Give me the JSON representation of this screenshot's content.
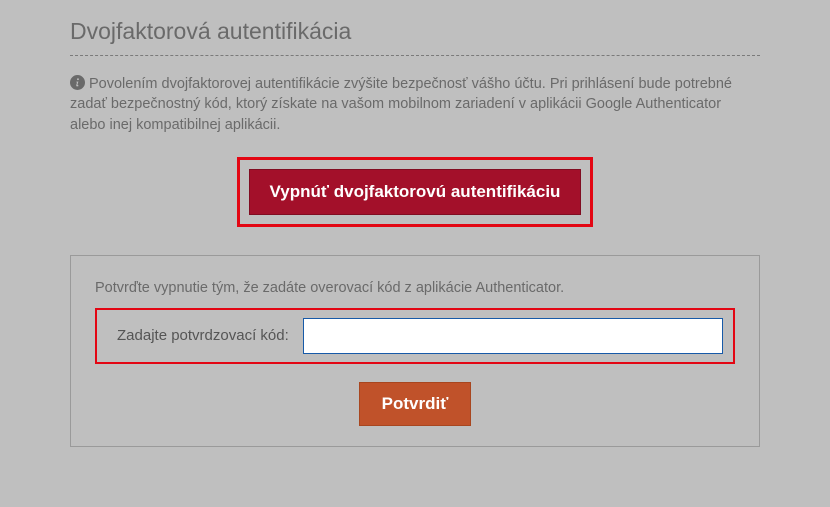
{
  "title": "Dvojfaktorová autentifikácia",
  "info_icon": "info-circle-icon",
  "info_text": "Povolením dvojfaktorovej autentifikácie zvýšite bezpečnosť vášho účtu. Pri prihlásení bude potrebné zadať bezpečnostný kód, ktorý získate na vašom mobilnom zariadení v aplikácii Google Authenticator alebo inej kompatibilnej aplikácii.",
  "disable_button_label": "Vypnúť dvojfaktorovú autentifikáciu",
  "confirm_panel": {
    "instruction": "Potvrďte vypnutie tým, že zadáte overovací kód z aplikácie Authenticator.",
    "field_label": "Zadajte potvrdzovací kód:",
    "code_value": "",
    "submit_label": "Potvrdiť"
  },
  "colors": {
    "highlight_border": "#e30613",
    "danger_bg": "#a3102a",
    "confirm_bg": "#c0522a",
    "text": "#6a6a6a",
    "input_border": "#175aa8"
  }
}
